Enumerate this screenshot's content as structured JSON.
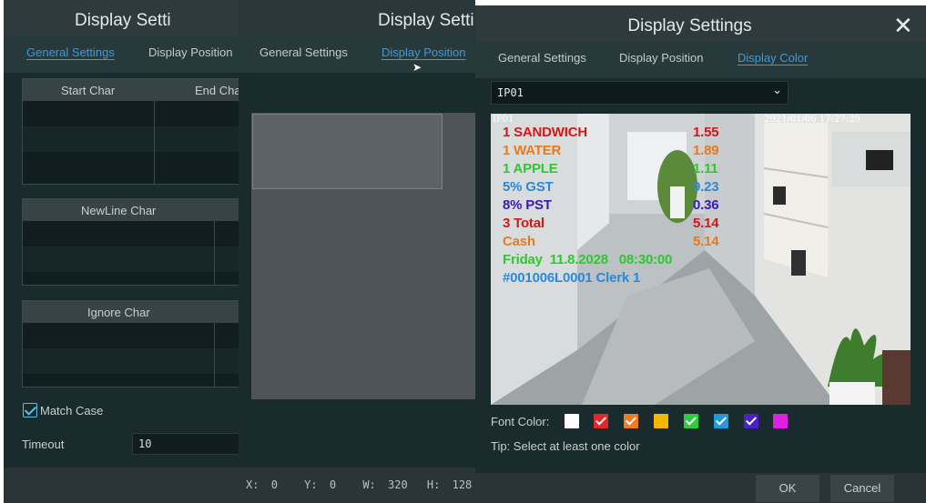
{
  "left_panel": {
    "title": "Display Setti",
    "tabs": [
      {
        "label": "General Settings",
        "active": true
      },
      {
        "label": "Display Position",
        "active": false
      }
    ],
    "start_table": {
      "col1": "Start Char",
      "col2": "End Cha"
    },
    "newline_table": {
      "col1": "NewLine Char"
    },
    "ignore_table": {
      "col1": "Ignore Char"
    },
    "match_case": {
      "label": "Match Case",
      "checked": true
    },
    "timeout": {
      "label": "Timeout",
      "value": "10"
    }
  },
  "middle_panel": {
    "title": "Display Setti",
    "tabs": [
      {
        "label": "General Settings",
        "active": false
      },
      {
        "label": "Display Position",
        "active": true
      }
    ],
    "coords": {
      "x_label": "X:",
      "x": "0",
      "y_label": "Y:",
      "y": "0",
      "w_label": "W:",
      "w": "320",
      "h_label": "H:",
      "h": "128"
    }
  },
  "right_panel": {
    "title": "Display Settings",
    "close_icon": "close-icon",
    "tabs": [
      {
        "label": "General Settings",
        "active": false
      },
      {
        "label": "Display Position",
        "active": false
      },
      {
        "label": "Display Color",
        "active": true
      }
    ],
    "channel": "IP01",
    "preview": {
      "osd_channel": "IP01",
      "osd_time": "2021/01/06 17:27:39",
      "receipt": [
        {
          "left": "1 SANDWICH",
          "right": "1.55",
          "color": "#d01818"
        },
        {
          "left": "1 WATER",
          "right": "1.89",
          "color": "#e87a1c"
        },
        {
          "left": "1 APPLE",
          "right": "1.11",
          "color": "#2ec82e"
        },
        {
          "left": "5% GST",
          "right": "9.23",
          "color": "#2a8ad8"
        },
        {
          "left": "8% PST",
          "right": "0.36",
          "color": "#3a1ab8"
        },
        {
          "left": "3 Total",
          "right": "5.14",
          "color": "#d01818"
        },
        {
          "left": "Cash",
          "right": "5.14",
          "color": "#e87a1c"
        },
        {
          "left": "Friday  11.8.2028   08:30:00",
          "right": "",
          "color": "#2ec82e"
        },
        {
          "left": "#001006L0001 Clerk 1",
          "right": "",
          "color": "#2a8ad8"
        }
      ]
    },
    "font_color_label": "Font Color:",
    "swatches": [
      {
        "color": "#ffffff",
        "checked": false
      },
      {
        "color": "#e02828",
        "checked": true
      },
      {
        "color": "#f07c1e",
        "checked": true
      },
      {
        "color": "#f5b800",
        "checked": false
      },
      {
        "color": "#2ecc40",
        "checked": true
      },
      {
        "color": "#1e9be0",
        "checked": true
      },
      {
        "color": "#4a22c8",
        "checked": true
      },
      {
        "color": "#e020e0",
        "checked": false
      }
    ],
    "tip": "Tip: Select at least one color",
    "ok_label": "OK",
    "cancel_label": "Cancel"
  }
}
